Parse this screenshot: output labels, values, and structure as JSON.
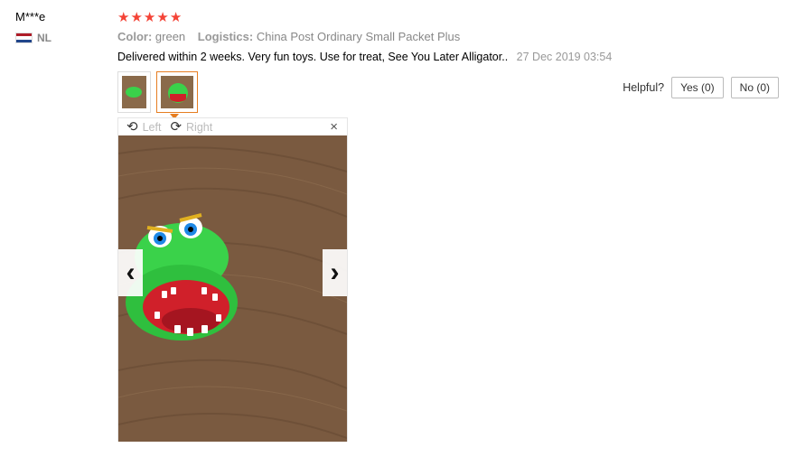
{
  "user": {
    "name": "M***e",
    "country_code": "NL",
    "flag_colors": [
      "#ae1c28",
      "#ffffff",
      "#21468b"
    ]
  },
  "review": {
    "rating": 5,
    "star_icon": "star-icon",
    "star_color": "#f44336",
    "attributes": [
      {
        "name": "Color:",
        "value": "green"
      },
      {
        "name": "Logistics:",
        "value": "China Post Ordinary Small Packet Plus"
      }
    ],
    "text": "Delivered within 2 weeks. Very fun toys. Use for treat, See You Later Alligator..",
    "date": "27 Dec 2019 03:54"
  },
  "helpful": {
    "label": "Helpful?",
    "yes_label": "Yes (0)",
    "no_label": "No (0)"
  },
  "viewer": {
    "rotate_left_label": "Left",
    "rotate_right_label": "Right",
    "close_icon": "close-icon",
    "close_glyph": "×",
    "prev_glyph": "‹",
    "next_glyph": "›",
    "active_thumb": 2,
    "thumb_count": 2
  },
  "colors": {
    "active_thumb_border": "#e67e22",
    "toy_green": "#3ad24a",
    "toy_red": "#d0202a"
  }
}
